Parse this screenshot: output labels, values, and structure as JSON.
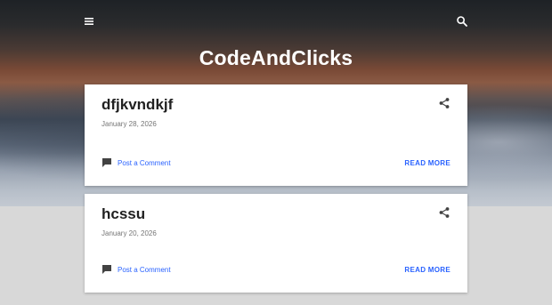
{
  "header": {
    "blog_title": "CodeAndClicks",
    "menu_icon": "hamburger-menu-icon",
    "search_icon": "search-icon"
  },
  "posts": [
    {
      "title": "dfjkvndkjf",
      "date": "January 28, 2026",
      "comment_label": "Post a Comment",
      "read_more_label": "READ MORE"
    },
    {
      "title": "hcssu",
      "date": "January 20, 2026",
      "comment_label": "Post a Comment",
      "read_more_label": "READ MORE"
    }
  ],
  "colors": {
    "link": "#2962ff",
    "title_text": "#212121",
    "date_text": "#757575"
  }
}
